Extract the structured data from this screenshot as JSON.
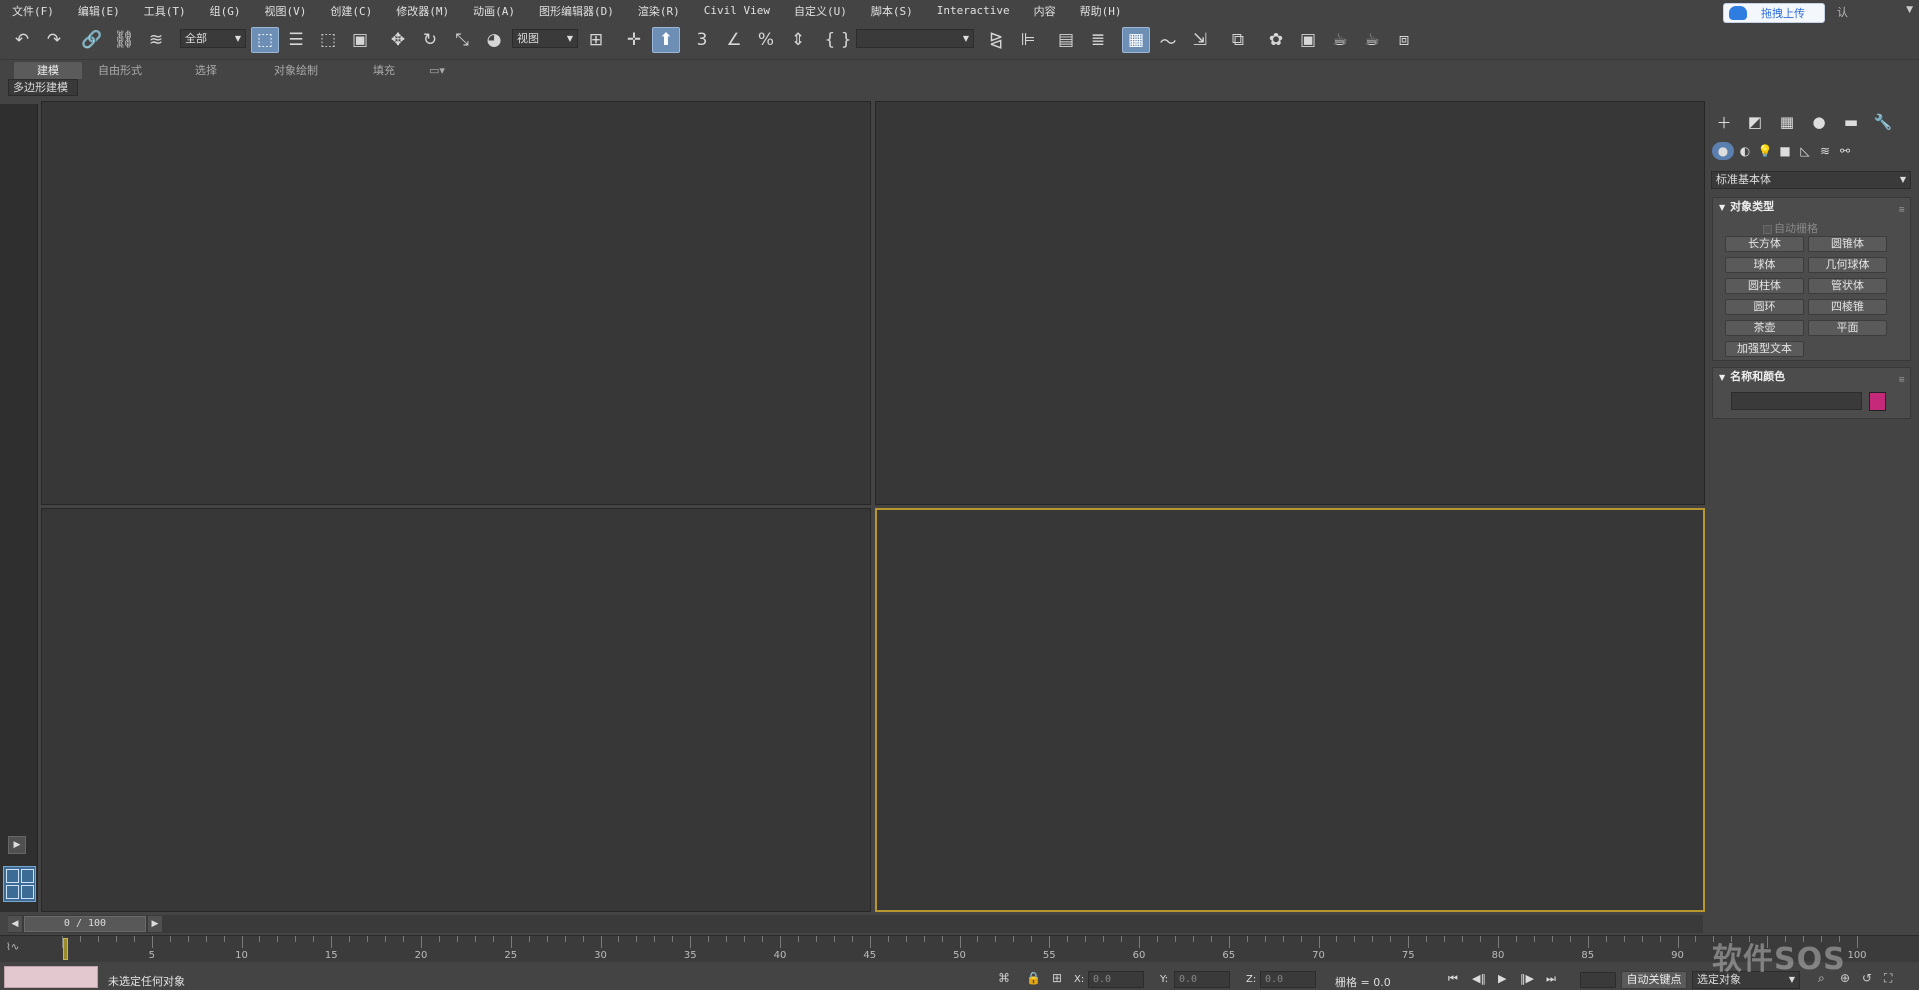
{
  "menu": [
    "文件(F)",
    "编辑(E)",
    "工具(T)",
    "组(G)",
    "视图(V)",
    "创建(C)",
    "修改器(M)",
    "动画(A)",
    "图形编辑器(D)",
    "渲染(R)",
    "Civil View",
    "自定义(U)",
    "脚本(S)",
    "Interactive",
    "内容",
    "帮助(H)"
  ],
  "upload_button": "拖拽上传",
  "workspace_label": "认",
  "toolbar": {
    "selection_filter": "全部",
    "ref_coord": "视图",
    "named_selection": ""
  },
  "ribbon": {
    "tabs": [
      "建模",
      "自由形式",
      "选择",
      "对象绘制",
      "填充"
    ],
    "active_tab": "建模",
    "sub_panel": "多边形建模"
  },
  "command_panel": {
    "category": "标准基本体",
    "object_type": {
      "title": "对象类型",
      "autogrid": "自动栅格",
      "buttons": [
        "长方体",
        "圆锥体",
        "球体",
        "几何球体",
        "圆柱体",
        "管状体",
        "圆环",
        "四棱锥",
        "茶壶",
        "平面",
        "加强型文本"
      ]
    },
    "name_color": {
      "title": "名称和颜色",
      "name_value": "",
      "color": "#c4297a"
    }
  },
  "time_slider": {
    "position": "0 / 100",
    "current_frame": 0,
    "total_frames": 100
  },
  "track_ruler": {
    "labels": [
      "5",
      "10",
      "15",
      "20",
      "25",
      "30",
      "35",
      "40",
      "45",
      "50",
      "55",
      "60",
      "65",
      "70",
      "75",
      "80",
      "85",
      "90",
      "100"
    ]
  },
  "status": {
    "message": "未选定任何对象",
    "x_label": "X:",
    "x_value": "0.0",
    "y_label": "Y:",
    "y_value": "0.0",
    "z_label": "Z:",
    "z_value": "0.0",
    "grid": "栅格 = 0.0",
    "autokey": "自动关键点",
    "key_filter": "选定对象"
  },
  "watermark": "软件SOS",
  "colors": {
    "active_viewport_border": "#b8972e",
    "accent": "#6d8fb5"
  }
}
